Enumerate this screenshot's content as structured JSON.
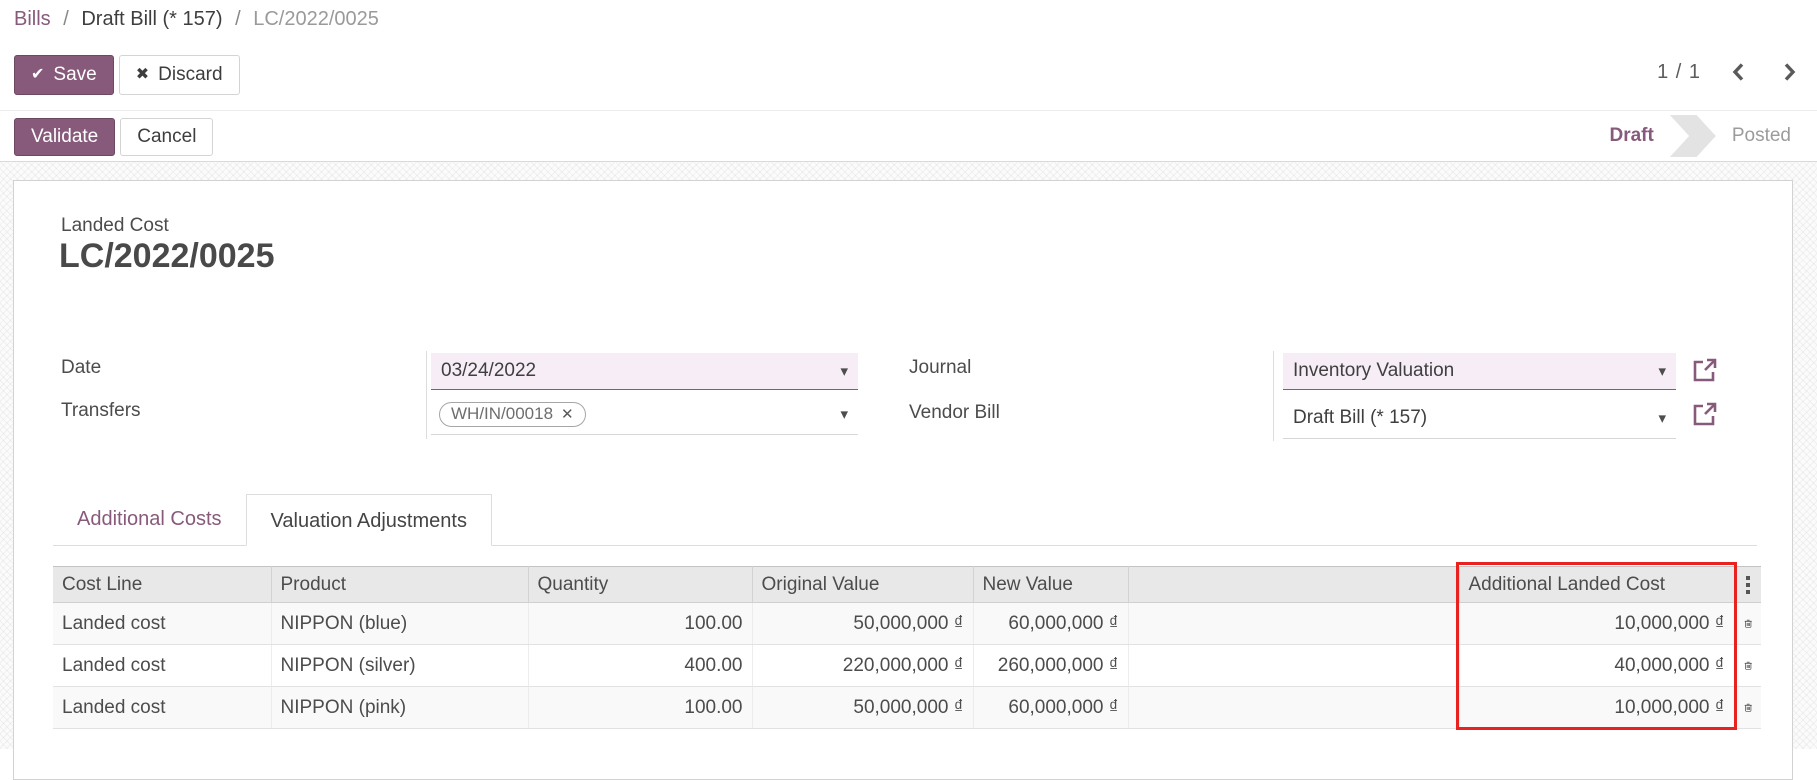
{
  "breadcrumb": {
    "separator": "/",
    "items": [
      "Bills",
      "Draft Bill (* 157)",
      "LC/2022/0025"
    ]
  },
  "header_actions": {
    "save": "Save",
    "discard": "Discard"
  },
  "pager": {
    "text": "1 / 1"
  },
  "action_bar": {
    "validate": "Validate",
    "cancel": "Cancel"
  },
  "statusbar": {
    "stages": [
      {
        "label": "Draft",
        "active": true
      },
      {
        "label": "Posted",
        "active": false
      }
    ]
  },
  "form": {
    "sheet_label": "Landed Cost",
    "title": "LC/2022/0025",
    "fields": {
      "date": {
        "label": "Date",
        "value": "03/24/2022"
      },
      "transfers": {
        "label": "Transfers",
        "tag": "WH/IN/00018"
      },
      "journal": {
        "label": "Journal",
        "value": "Inventory Valuation"
      },
      "vendor_bill": {
        "label": "Vendor Bill",
        "value": "Draft Bill (* 157)"
      }
    },
    "tabs": [
      {
        "label": "Additional Costs",
        "active": false
      },
      {
        "label": "Valuation Adjustments",
        "active": true
      }
    ]
  },
  "table": {
    "columns": [
      "Cost Line",
      "Product",
      "Quantity",
      "Original Value",
      "New Value",
      "",
      "Additional Landed Cost"
    ],
    "rows": [
      {
        "cost_line": "Landed cost",
        "product": "NIPPON (blue)",
        "quantity": "100.00",
        "original_value": "50,000,000 ₫",
        "new_value": "60,000,000 ₫",
        "additional_landed_cost": "10,000,000 ₫"
      },
      {
        "cost_line": "Landed cost",
        "product": "NIPPON (silver)",
        "quantity": "400.00",
        "original_value": "220,000,000 ₫",
        "new_value": "260,000,000 ₫",
        "additional_landed_cost": "40,000,000 ₫"
      },
      {
        "cost_line": "Landed cost",
        "product": "NIPPON (pink)",
        "quantity": "100.00",
        "original_value": "50,000,000 ₫",
        "new_value": "60,000,000 ₫",
        "additional_landed_cost": "10,000,000 ₫"
      }
    ]
  },
  "icons": {
    "check": "✔",
    "x_mark": "✖",
    "tag_remove": "✕",
    "caret": "▾"
  },
  "colors": {
    "accent": "#875a7b",
    "highlight_red": "#e8231f",
    "required_field_bg": "#f6edf7"
  }
}
